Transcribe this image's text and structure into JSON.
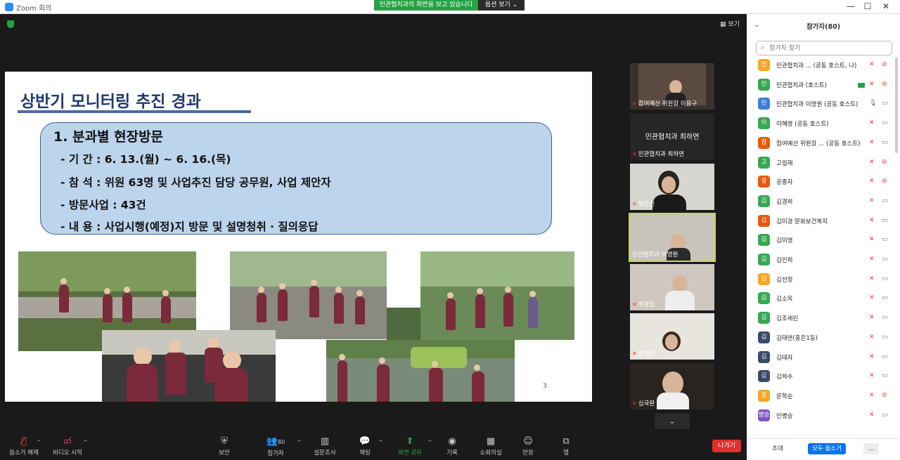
{
  "titlebar": {
    "app_title": "Zoom 회의",
    "sharing_banner": "민관협치과의 화면을 보고 있습니다",
    "view_options": "옵션 보기 ⌄",
    "minimize": "—",
    "maximize": "☐",
    "close": "✕"
  },
  "main": {
    "view_label": "보기"
  },
  "slide": {
    "title": "상반기 모니터링 추진 경과",
    "heading": "1. 분과별 현장방문",
    "lines": [
      "- 기      간 : 6. 13.(월) ~ 6. 16.(목)",
      "- 참      석 : 위원 63명 및 사업추진 담당 공무원, 사업 제안자",
      "- 방문사업 : 43건",
      "- 내      용 : 사업시행(예정)지 방문 및 설명청취 · 질의응답"
    ],
    "page_number": "3"
  },
  "tiles": [
    {
      "name": "참여예산 위원장 이용구"
    },
    {
      "name": "민관협치과 최하연",
      "big_text": "민관협치과 최하연"
    },
    {
      "name": "박은진"
    },
    {
      "name": "민관협치과 이명원"
    },
    {
      "name": "최경심"
    },
    {
      "name": "양재민"
    },
    {
      "name": "심국환"
    }
  ],
  "toolbar": {
    "mute": "음소거 해제",
    "video": "비디오 시작",
    "security": "보안",
    "participants": "참가자",
    "participants_count": "80",
    "polls": "설문조사",
    "chat": "채팅",
    "share": "화면 공유",
    "record": "기록",
    "breakout": "소회의실",
    "reactions": "반응",
    "apps": "앱",
    "leave": "나가기"
  },
  "panel": {
    "title": "참가자(80)",
    "search_placeholder": "참가자 찾기",
    "participants": [
      {
        "avatar": "민",
        "color": "#f5a623",
        "name": "민관협치과 ...  (공동 호스트, 나)",
        "mic": "off",
        "cam": "off"
      },
      {
        "avatar": "민",
        "color": "#36a852",
        "name": "민관협치과 (호스트)",
        "mic": "off",
        "cam": "off",
        "sharing": true
      },
      {
        "avatar": "민",
        "color": "#3b7dd8",
        "name": "민관협치과 이명원 (공동 호스트)",
        "mic": "on",
        "cam": "on"
      },
      {
        "avatar": "이",
        "color": "#36a852",
        "name": "이혜영 (공동 호스트)",
        "mic": "off",
        "cam": "on"
      },
      {
        "avatar": "참",
        "color": "#e8590c",
        "name": "참여예산 위원장 ... (공동 호스트)",
        "mic": "off",
        "cam": "on"
      },
      {
        "avatar": "고",
        "color": "#36a852",
        "name": "고필재",
        "mic": "off",
        "cam": "off"
      },
      {
        "avatar": "공",
        "color": "#e8590c",
        "name": "공종자",
        "mic": "off",
        "cam": "off"
      },
      {
        "avatar": "김",
        "color": "#36a852",
        "name": "김경희",
        "mic": "off",
        "cam": "on"
      },
      {
        "avatar": "김",
        "color": "#e8590c",
        "name": "김미경 문화보건복지",
        "mic": "off",
        "cam": "on"
      },
      {
        "avatar": "김",
        "color": "#36a852",
        "name": "김미영",
        "mic": "off",
        "cam": "on"
      },
      {
        "avatar": "김",
        "color": "#36a852",
        "name": "김민희",
        "mic": "off",
        "cam": "on"
      },
      {
        "avatar": "김",
        "color": "#f5a623",
        "name": "김선정",
        "mic": "off",
        "cam": "on"
      },
      {
        "avatar": "김",
        "color": "#36a852",
        "name": "김소옥",
        "mic": "off",
        "cam": "on"
      },
      {
        "avatar": "김",
        "color": "#36a852",
        "name": "김조세린",
        "mic": "off",
        "cam": "on"
      },
      {
        "avatar": "김",
        "color": "#3a4a6b",
        "name": "김태연(홍은1동)",
        "mic": "off",
        "cam": "on"
      },
      {
        "avatar": "김",
        "color": "#3a4a6b",
        "name": "김태자",
        "mic": "off",
        "cam": "on"
      },
      {
        "avatar": "김",
        "color": "#3a4a6b",
        "name": "김희수",
        "mic": "off",
        "cam": "on"
      },
      {
        "avatar": "문",
        "color": "#f5a623",
        "name": "문학순",
        "mic": "off",
        "cam": "off"
      },
      {
        "avatar": "병승",
        "color": "#7e57c2",
        "name": "민병승",
        "mic": "off",
        "cam": "on"
      }
    ],
    "invite": "초대",
    "mute_all": "모두 음소거",
    "more": "..."
  }
}
